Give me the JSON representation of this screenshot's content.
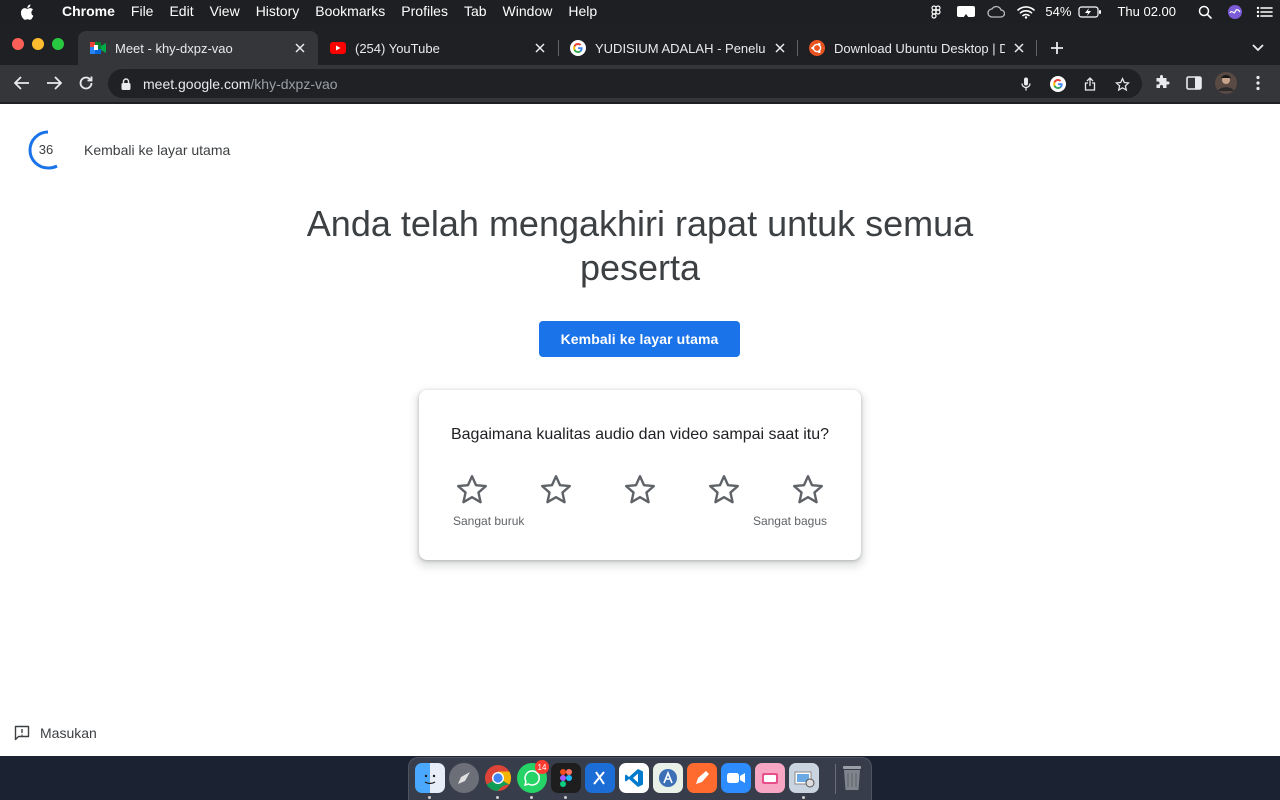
{
  "menubar": {
    "app": "Chrome",
    "items": [
      "File",
      "Edit",
      "View",
      "History",
      "Bookmarks",
      "Profiles",
      "Tab",
      "Window",
      "Help"
    ],
    "battery": "54%",
    "clock": "Thu 02.00"
  },
  "tabs": [
    {
      "title": "Meet - khy-dxpz-vao",
      "active": true,
      "icon": "google-meet-icon"
    },
    {
      "title": "(254) YouTube",
      "active": false,
      "icon": "youtube-icon"
    },
    {
      "title": "YUDISIUM ADALAH - Penelusu",
      "active": false,
      "icon": "google-icon"
    },
    {
      "title": "Download Ubuntu Desktop | Do",
      "active": false,
      "icon": "ubuntu-icon"
    }
  ],
  "omnibox": {
    "host": "meet.google.com",
    "path": "/khy-dxpz-vao"
  },
  "page": {
    "countdown": "36",
    "return_link": "Kembali ke layar utama",
    "headline": "Anda telah mengakhiri rapat untuk semua peserta",
    "primary_button": "Kembali ke layar utama",
    "rating": {
      "question": "Bagaimana kualitas audio dan video sampai saat itu?",
      "max_stars": 5,
      "low_label": "Sangat buruk",
      "high_label": "Sangat bagus"
    },
    "feedback": "Masukan"
  },
  "dock": {
    "apps": [
      "finder-icon",
      "launchpad-icon",
      "chrome-icon",
      "whatsapp-icon",
      "figma-icon",
      "xcode-icon",
      "vscode-icon",
      "android-studio-icon",
      "pencil-icon",
      "zoom-icon",
      "pink-app-icon",
      "preview-icon",
      "trash-icon"
    ],
    "whatsapp_badge": "14"
  },
  "colors": {
    "accent": "#1a73e8",
    "tab_active": "#35363a",
    "tab_strip": "#1f2023"
  }
}
